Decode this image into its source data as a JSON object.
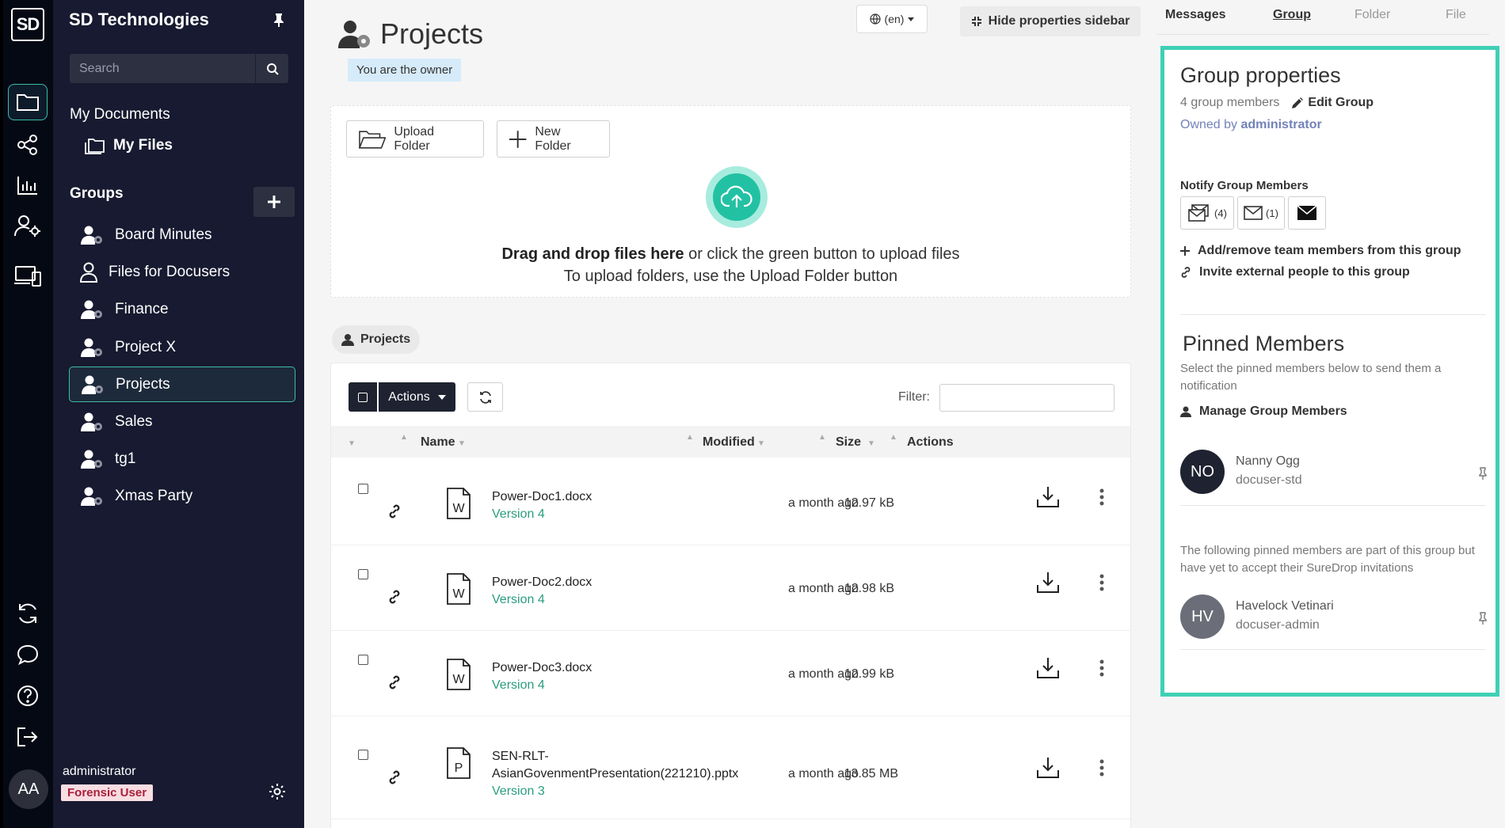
{
  "rail": {
    "logo": "SD",
    "avatar_initials": "AA"
  },
  "sidebar": {
    "brand": "SD Technologies",
    "search_placeholder": "Search",
    "my_documents": "My Documents",
    "my_files": "My Files",
    "groups_heading": "Groups",
    "groups": [
      {
        "label": "Board Minutes",
        "icon": "group-owner-icon"
      },
      {
        "label": "Files for Docusers",
        "icon": "user-icon"
      },
      {
        "label": "Finance",
        "icon": "group-owner-icon"
      },
      {
        "label": "Project X",
        "icon": "group-owner-icon"
      },
      {
        "label": "Projects",
        "icon": "group-owner-icon",
        "active": true
      },
      {
        "label": "Sales",
        "icon": "group-owner-icon"
      },
      {
        "label": "tg1",
        "icon": "group-owner-icon"
      },
      {
        "label": "Xmas Party",
        "icon": "group-owner-icon"
      }
    ],
    "user_name": "administrator",
    "user_badge": "Forensic User"
  },
  "header": {
    "title": "Projects",
    "owner_badge": "You are the owner",
    "language": "(en)",
    "hide_sidebar_label": "Hide properties sidebar"
  },
  "upload": {
    "upload_folder_label": "Upload Folder",
    "new_folder_label": "New Folder",
    "drag_bold": "Drag and drop files here",
    "drag_rest": " or click the green button to upload files",
    "folder_hint": "To upload folders, use the Upload Folder button"
  },
  "breadcrumb": {
    "label": "Projects"
  },
  "table": {
    "actions_label": "Actions",
    "filter_label": "Filter:",
    "filter_value": "",
    "columns": {
      "name": "Name",
      "modified": "Modified",
      "size": "Size",
      "actions": "Actions"
    },
    "rows": [
      {
        "name": "Power-Doc1.docx",
        "version": "Version 4",
        "modified": "a month ago",
        "size": "12.97 kB",
        "type": "word"
      },
      {
        "name": "Power-Doc2.docx",
        "version": "Version 4",
        "modified": "a month ago",
        "size": "12.98 kB",
        "type": "word"
      },
      {
        "name": "Power-Doc3.docx",
        "version": "Version 4",
        "modified": "a month ago",
        "size": "12.99 kB",
        "type": "word"
      },
      {
        "name_line1": "SEN-RLT-",
        "name_line2": "AsianGovenmentPresentation(221210).pptx",
        "version": "Version 3",
        "modified": "a month ago",
        "size": "13.85 MB",
        "type": "powerpoint"
      }
    ]
  },
  "panel": {
    "tabs": [
      "Messages",
      "Group",
      "Folder",
      "File"
    ],
    "selected_tab": "Group",
    "title": "Group properties",
    "member_count": "4 group members",
    "edit_group": "Edit Group",
    "owned_by_prefix": "Owned by ",
    "owner": "administrator",
    "notify_heading": "Notify Group Members",
    "notify_counts": [
      "(4)",
      "(1)"
    ],
    "add_remove": "Add/remove team members from this group",
    "invite": "Invite external people to this group",
    "pinned_title": "Pinned Members",
    "pinned_sub": "Select the pinned members below to send them a notification",
    "manage_members": "Manage Group Members",
    "members": [
      {
        "initials": "NO",
        "name": "Nanny Ogg",
        "role": "docuser-std",
        "color": "#1f2230"
      },
      {
        "initials": "HV",
        "name": "Havelock Vetinari",
        "role": "docuser-admin",
        "color": "#6b6e78"
      }
    ],
    "pending_note": "The following pinned members are part of this group but have yet to accept their SureDrop invitations"
  },
  "colors": {
    "accent": "#3fd0b5",
    "sidebar_bg": "#171a30",
    "rail_bg": "#050914",
    "version_green": "#2a9d7e"
  }
}
